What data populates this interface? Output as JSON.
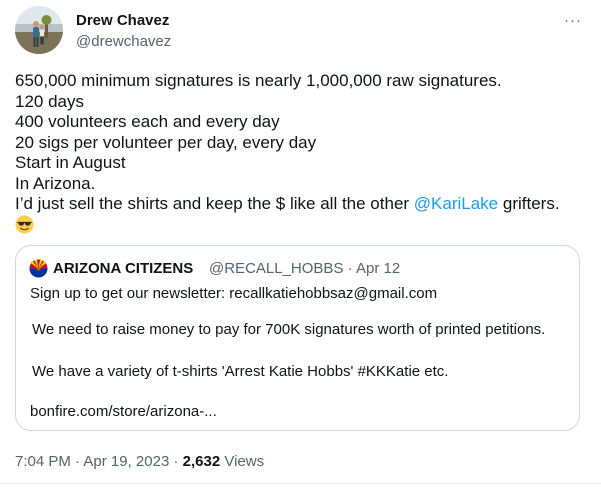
{
  "author": {
    "name": "Drew Chavez",
    "handle": "@drewchavez"
  },
  "more_label": "···",
  "tweet": {
    "lines": [
      "650,000 minimum signatures is nearly 1,000,000 raw signatures.",
      "120 days",
      "400 volunteers each and every day",
      "20 sigs per volunteer per day, every day",
      "Start in August",
      "In Arizona."
    ],
    "last_line_prefix": "I’d just sell the shirts and keep the $ like all the other ",
    "mention": "@KariLake",
    "last_line_suffix": " grifters.",
    "emoji": "smiling-face-with-sunglasses"
  },
  "quote": {
    "name": "ARIZONA CITIZENS",
    "handle": "@RECALL_HOBBS",
    "separator": "·",
    "date": "Apr 12",
    "line1": "Sign up to get our newsletter: recallkatiehobbsaz@gmail.com",
    "line2": "We need to raise money to pay for 700K signatures worth of printed petitions.",
    "line3": "We have a variety of t-shirts  'Arrest Katie Hobbs' #KKKatie etc.",
    "line4": "bonfire.com/store/arizona-..."
  },
  "footer": {
    "time": "7:04 PM",
    "sep": "·",
    "date": "Apr 19, 2023",
    "sep2": "·",
    "views_count": "2,632",
    "views_label": "Views"
  }
}
